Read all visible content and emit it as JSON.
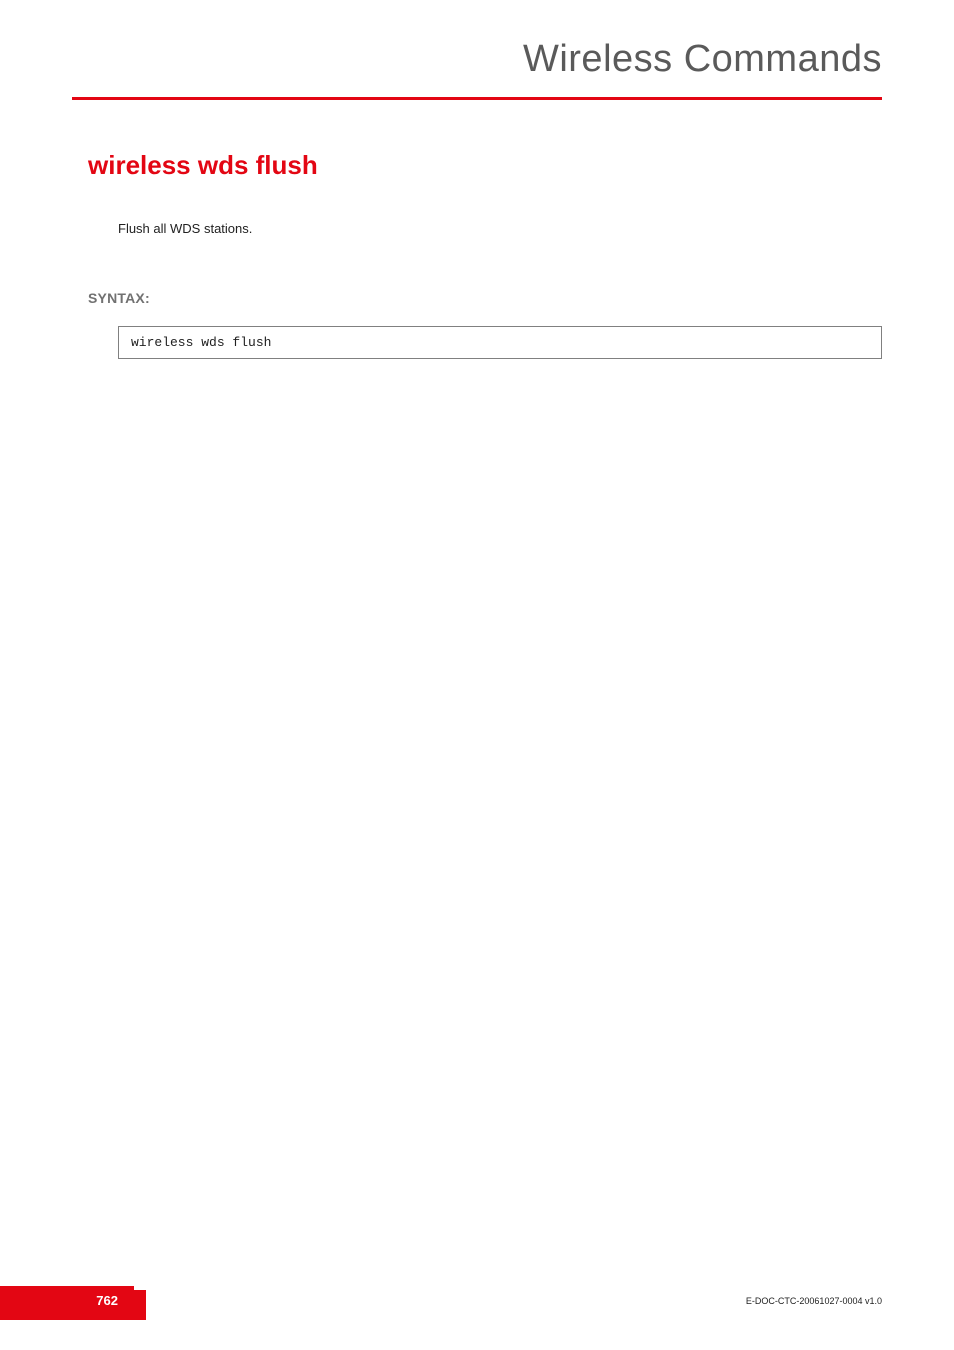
{
  "header": {
    "chapter_title": "Wireless Commands"
  },
  "main": {
    "command_title": "wireless wds flush",
    "description": "Flush all WDS stations.",
    "syntax_label": "SYNTAX:",
    "code": "wireless wds flush"
  },
  "footer": {
    "page_number": "762",
    "doc_id": "E-DOC-CTC-20061027-0004 v1.0"
  }
}
